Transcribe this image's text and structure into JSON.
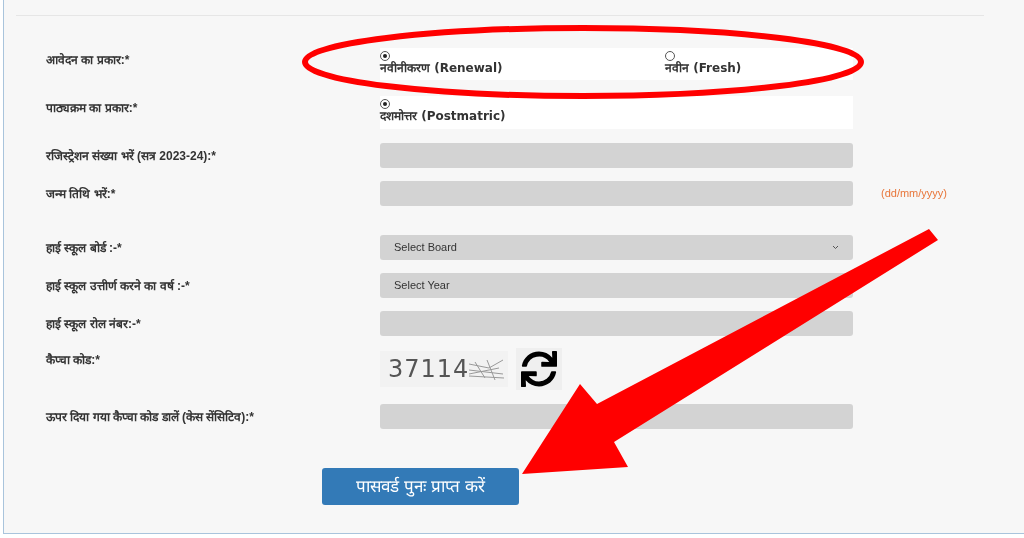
{
  "form": {
    "rows": [
      {
        "kind": "radio",
        "label": "आवेदन का प्रकार:*",
        "options": [
          {
            "label": "नवीनीकरण (Renewal)",
            "selected": true
          },
          {
            "label": "नवीन (Fresh)",
            "selected": false
          }
        ]
      },
      {
        "kind": "radio",
        "label": "पाठ्यक्रम का प्रकार:*",
        "options": [
          {
            "label": "दशमोत्तर (Postmatric)",
            "selected": true
          }
        ]
      },
      {
        "kind": "text",
        "label": "रजिस्ट्रेशन संख्या भरें (सत्र 2023-24):*"
      },
      {
        "kind": "text",
        "label": "जन्म तिथि भरें:*",
        "hint": "(dd/mm/yyyy)"
      },
      {
        "kind": "select",
        "label": "हाई स्कूल बोर्ड :-*",
        "value": "Select Board"
      },
      {
        "kind": "select",
        "label": "हाई स्कूल उत्तीर्ण करने का वर्ष :-*",
        "value": "Select Year"
      },
      {
        "kind": "text",
        "label": "हाई स्कूल रोल नंबर:-*"
      },
      {
        "kind": "captcha",
        "label": "कैप्चा कोड:*",
        "code": "37114"
      },
      {
        "kind": "text",
        "label": "ऊपर दिया गया कैप्चा कोड डालें (केस सेंसिटिव):*"
      }
    ],
    "submit": "पासवर्ड पुनः प्राप्त करें"
  }
}
